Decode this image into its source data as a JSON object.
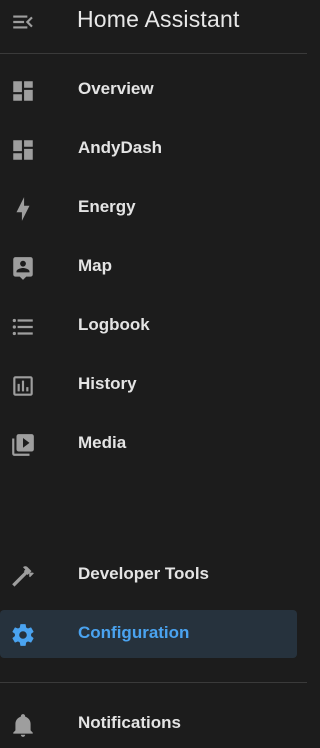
{
  "header": {
    "title": "Home Assistant",
    "menu_icon": "menu-open-icon"
  },
  "nav": {
    "items": [
      {
        "label": "Overview",
        "icon": "view-dashboard-icon"
      },
      {
        "label": "AndyDash",
        "icon": "view-dashboard-icon"
      },
      {
        "label": "Energy",
        "icon": "lightning-bolt-icon"
      },
      {
        "label": "Map",
        "icon": "account-box-icon"
      },
      {
        "label": "Logbook",
        "icon": "format-list-bulleted-icon"
      },
      {
        "label": "History",
        "icon": "chart-box-icon"
      },
      {
        "label": "Media",
        "icon": "play-box-multiple-icon"
      }
    ],
    "bottom": [
      {
        "label": "Developer Tools",
        "icon": "hammer-icon"
      },
      {
        "label": "Configuration",
        "icon": "cog-icon",
        "active": true
      }
    ],
    "notifications": {
      "label": "Notifications",
      "icon": "bell-icon"
    }
  },
  "colors": {
    "background": "#1c1c1c",
    "accent": "#4aa3f0",
    "icon": "#9e9e9e",
    "active_bg": "#26323d"
  }
}
